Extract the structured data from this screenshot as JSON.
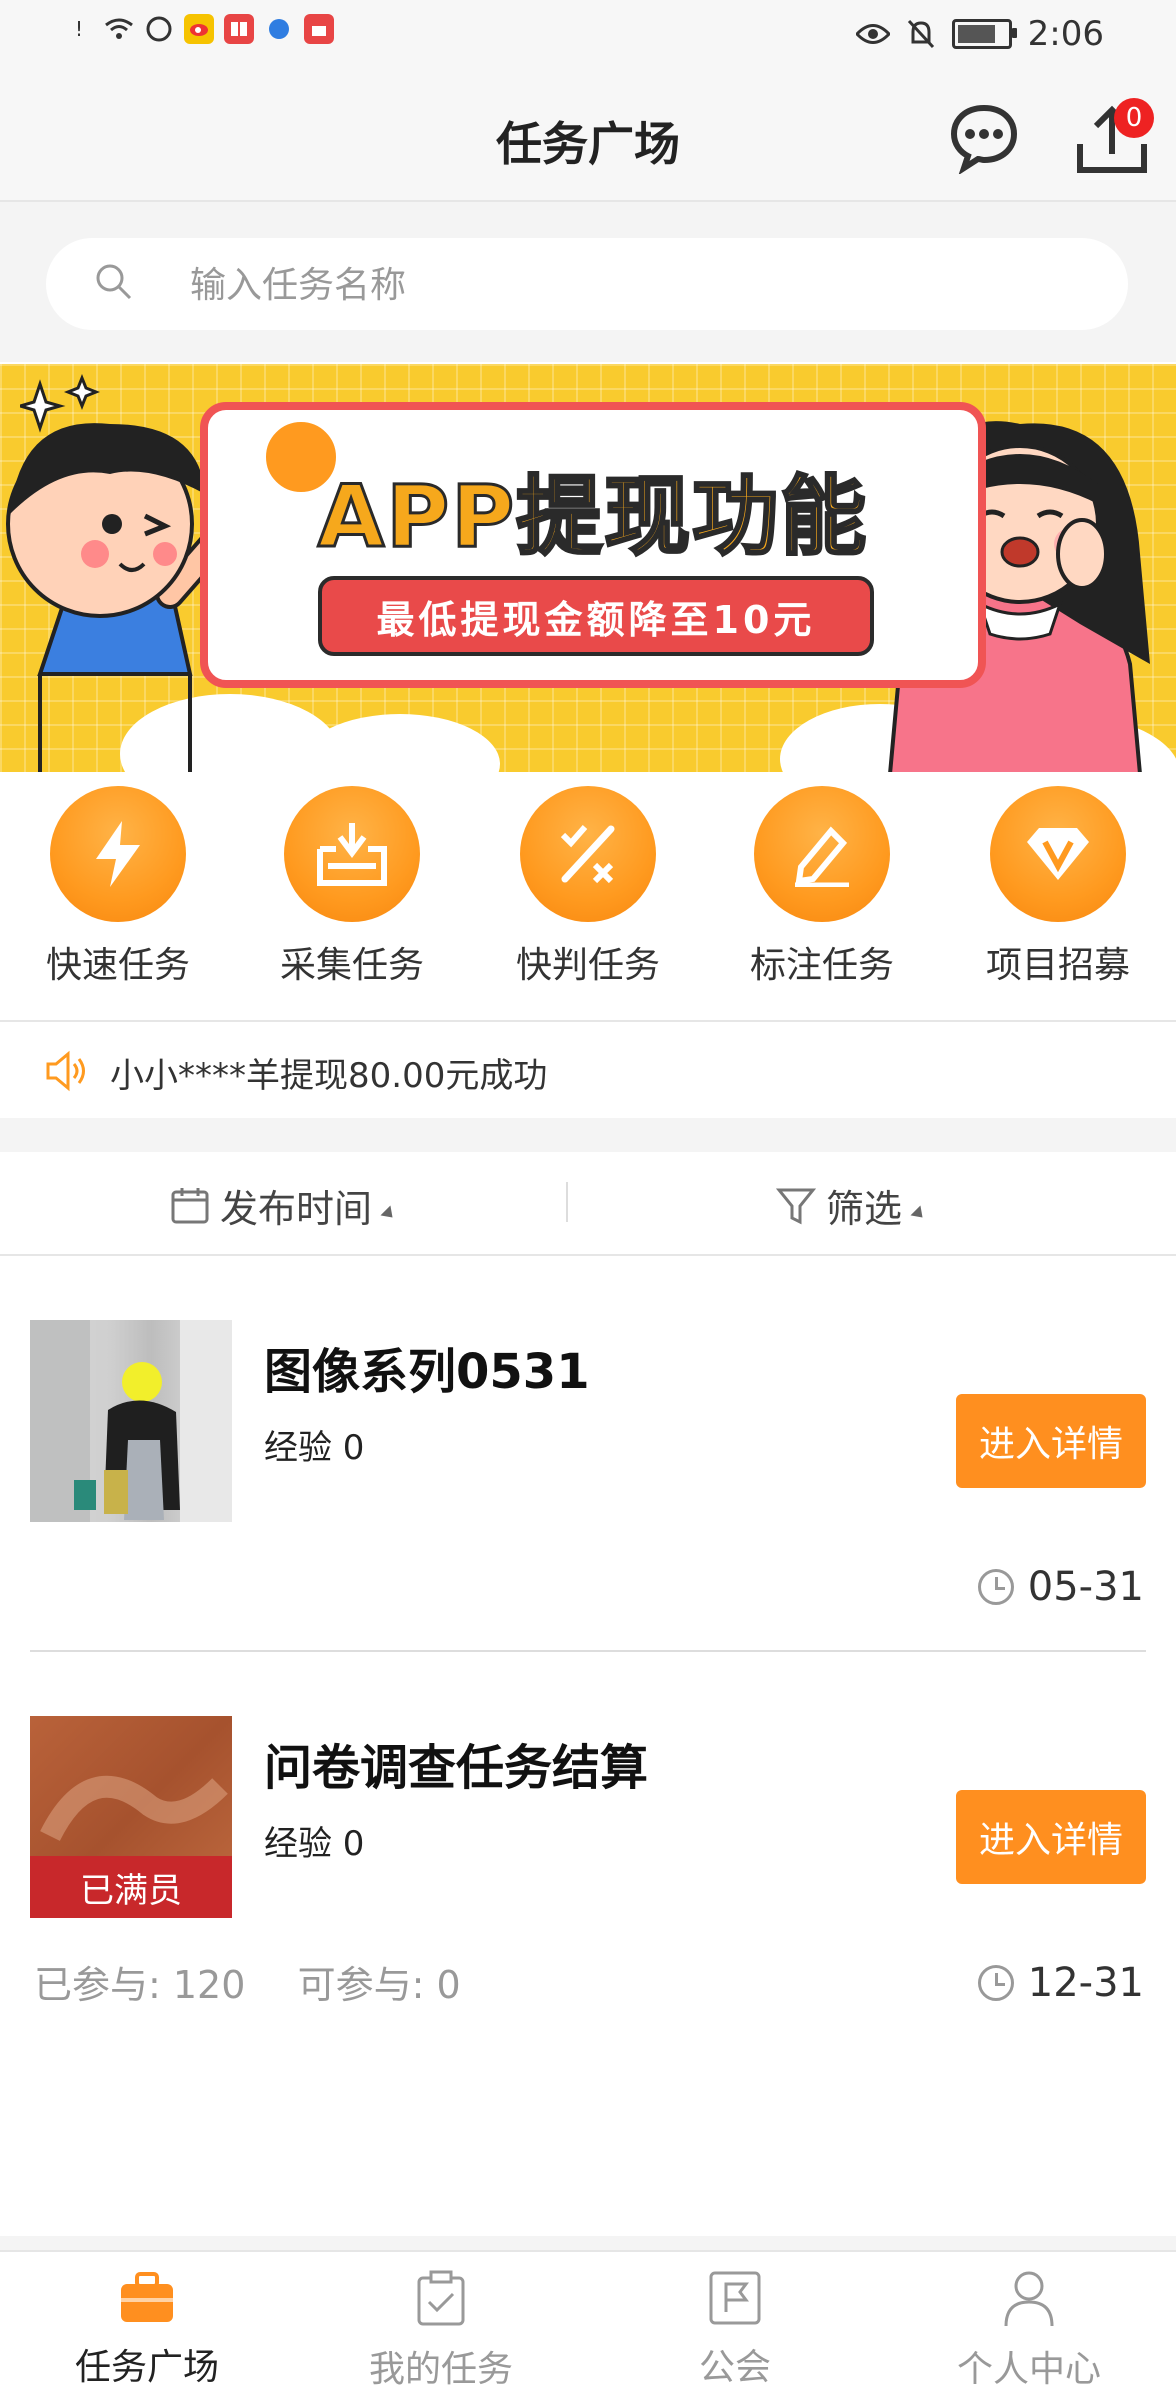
{
  "status_bar": {
    "time": "2:06"
  },
  "header": {
    "title": "任务广场",
    "upload_badge": "0"
  },
  "search": {
    "placeholder": "输入任务名称",
    "value": ""
  },
  "banner": {
    "title": "APP提现功能",
    "subtitle": "最低提现金额降至10元"
  },
  "categories": [
    {
      "label": "快速任务",
      "icon": "lightning-icon"
    },
    {
      "label": "采集任务",
      "icon": "collect-icon"
    },
    {
      "label": "快判任务",
      "icon": "judge-icon"
    },
    {
      "label": "标注任务",
      "icon": "pencil-icon"
    },
    {
      "label": "项目招募",
      "icon": "diamond-icon"
    }
  ],
  "notice": {
    "text": "小小****羊提现80.00元成功"
  },
  "filters": {
    "time_label": "发布时间",
    "filter_label": "筛选"
  },
  "tasks": [
    {
      "title": "图像系列0531",
      "exp": "经验 0",
      "button": "进入详情",
      "date": "05-31"
    },
    {
      "title": "问卷调查任务结算",
      "exp": "经验 0",
      "button": "进入详情",
      "date": "12-31",
      "status": "已满员",
      "joined": "已参与: 120",
      "available": "可参与: 0"
    }
  ],
  "bottom_nav": [
    {
      "label": "任务广场",
      "icon": "briefcase-icon",
      "active": true
    },
    {
      "label": "我的任务",
      "icon": "clipboard-icon",
      "active": false
    },
    {
      "label": "公会",
      "icon": "flag-icon",
      "active": false
    },
    {
      "label": "个人中心",
      "icon": "user-icon",
      "active": false
    }
  ],
  "colors": {
    "accent": "#ff8f1f",
    "badge": "#e22222",
    "full": "#c8282b",
    "banner_bg": "#f9cb2e"
  }
}
